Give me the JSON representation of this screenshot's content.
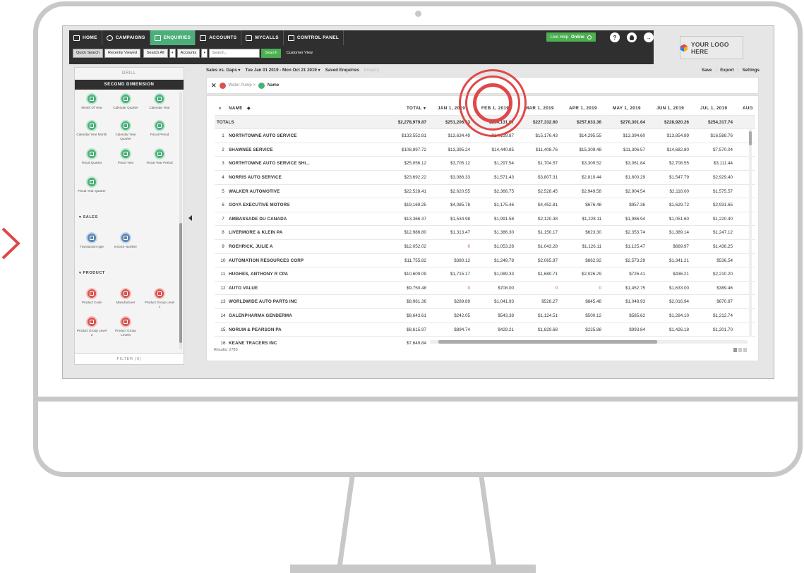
{
  "nav": {
    "items": [
      {
        "label": "HOME",
        "icon": "home-icon"
      },
      {
        "label": "CAMPAIGNS",
        "icon": "campaigns-icon"
      },
      {
        "label": "ENQUIRIES",
        "icon": "enquiries-icon",
        "active": true
      },
      {
        "label": "ACCOUNTS",
        "icon": "bank-icon"
      },
      {
        "label": "MYCALLS",
        "icon": "calls-icon"
      },
      {
        "label": "CONTROL PANEL",
        "icon": "control-panel-icon"
      }
    ],
    "help_prefix": "Live Help",
    "help_status": "Online",
    "help_q": "?",
    "logo_text": "YOUR LOGO HERE"
  },
  "search": {
    "quick": "Quick Search",
    "recent": "Recently Viewed",
    "scope": "Search All",
    "entity": "Accounts",
    "placeholder": "Search...",
    "button": "Search",
    "customer_view": "Customer View"
  },
  "left": {
    "drill": "DRILL",
    "second_dimension": "SECOND DIMENSION",
    "time_items": [
      "Month Of Year",
      "Calendar Quarter",
      "Calendar Year",
      "Calendar Year Month",
      "Calendar Year Quarter",
      "Fiscal Period",
      "Fiscal Quarter",
      "Fiscal Year",
      "Fiscal Year Period",
      "Fiscal Year Quarter"
    ],
    "sales_head": "SALES",
    "sales_items": [
      "Transaction type",
      "Invoice Number"
    ],
    "product_head": "PRODUCT",
    "product_items": [
      "Product Code",
      "Manufacturer",
      "Product Group Level 1",
      "Product Group Level 2",
      "Product Group Level3"
    ],
    "filter": "FILTER (0)"
  },
  "toolbar": {
    "report": "Sales vs. Gaps",
    "range": "Tue Jan 01 2019 - Mon Oct 21 2019",
    "saved": "Saved Enquiries",
    "enquiry": "Enquiry",
    "save": "Save",
    "export": "Export",
    "settings": "Settings"
  },
  "breadcrumb": {
    "x": "✕",
    "first": "Water Pump >",
    "second": "Name"
  },
  "table": {
    "headers": {
      "name": "NAME",
      "total": "TOTAL",
      "months": [
        "JAN 1, 2019",
        "FEB 1, 2019",
        "MAR 1, 2019",
        "APR 1, 2019",
        "MAY 1, 2019",
        "JUN 1, 2019",
        "JUL 1, 2019",
        "AUG"
      ]
    },
    "totals": {
      "label": "TOTALS",
      "total": "$2,278,979.87",
      "months": [
        "$251,206.63",
        "$214,131.67",
        "$227,332.60",
        "$257,633.36",
        "$270,301.64",
        "$228,920.26",
        "$254,317.74",
        "$"
      ]
    },
    "rows": [
      {
        "idx": "1",
        "name": "NORTHTOWNE AUTO SERVICE",
        "total": "$133,552.81",
        "months": [
          "$13,634.49",
          "$14,159.87",
          "$15,176.43",
          "$14,295.55",
          "$13,394.60",
          "$13,854.89",
          "$16,588.76"
        ]
      },
      {
        "idx": "2",
        "name": "SHAWNEE SERVICE",
        "total": "$108,897.72",
        "months": [
          "$13,395.24",
          "$14,440.85",
          "$11,408.76",
          "$15,309.48",
          "$11,306.57",
          "$14,682.80",
          "$7,570.04"
        ]
      },
      {
        "idx": "3",
        "name": "NORTHTOWNE AUTO SERVICE SHI...",
        "total": "$25,056.12",
        "months": [
          "$3,705.12",
          "$1,297.54",
          "$1,704.57",
          "$3,309.52",
          "$3,061.84",
          "$2,708.55",
          "$3,111.44"
        ]
      },
      {
        "idx": "4",
        "name": "NORRIS AUTO SERVICE",
        "total": "$23,692.22",
        "months": [
          "$3,086.33",
          "$1,571.43",
          "$3,807.31",
          "$2,810.44",
          "$1,600.29",
          "$1,547.79",
          "$2,929.40"
        ]
      },
      {
        "idx": "5",
        "name": "WALKER AUTOMOTIVE",
        "total": "$22,528.41",
        "months": [
          "$2,620.55",
          "$2,366.75",
          "$2,528.45",
          "$2,949.58",
          "$2,904.54",
          "$2,118.00",
          "$1,575.57"
        ]
      },
      {
        "idx": "6",
        "name": "GOYA EXECUTIVE MOTORS",
        "total": "$19,169.25",
        "months": [
          "$4,085.78",
          "$1,175.46",
          "$4,452.81",
          "$676.48",
          "$957.36",
          "$1,629.72",
          "$2,931.65"
        ]
      },
      {
        "idx": "7",
        "name": "AMBASSADE DU CANADA",
        "total": "$13,366.37",
        "months": [
          "$1,534.98",
          "$1,991.58",
          "$2,120.38",
          "$1,228.11",
          "$1,986.94",
          "$1,051.60",
          "$1,220.40"
        ]
      },
      {
        "idx": "8",
        "name": "LIVERMORE & KLEIN PA",
        "total": "$12,986.80",
        "months": [
          "$1,313.47",
          "$1,386.30",
          "$1,150.17",
          "$623.30",
          "$2,353.74",
          "$1,389.14",
          "$1,247.12"
        ]
      },
      {
        "idx": "9",
        "name": "ROEHRICK, JULIE A",
        "total": "$12,052.02",
        "months": [
          "0",
          "$1,053.28",
          "$1,043.28",
          "$1,126.11",
          "$1,125.47",
          "$669.97",
          "$1,436.25"
        ]
      },
      {
        "idx": "10",
        "name": "AUTOMATION RESOURCES CORP",
        "total": "$11,755.82",
        "months": [
          "$380.12",
          "$1,249.78",
          "$2,065.97",
          "$862.92",
          "$2,573.29",
          "$1,341.21",
          "$536.54"
        ]
      },
      {
        "idx": "11",
        "name": "HUGHES, ANTHONY R CPA",
        "total": "$10,609.09",
        "months": [
          "$1,715.17",
          "$1,089.33",
          "$1,680.71",
          "$2,026.29",
          "$726.41",
          "$436.21",
          "$2,210.20"
        ]
      },
      {
        "idx": "12",
        "name": "AUTO VALUE",
        "total": "$9,750.48",
        "months": [
          "0",
          "$708.00",
          "0",
          "0",
          "$1,452.75",
          "$1,633.00",
          "$389.46"
        ]
      },
      {
        "idx": "13",
        "name": "WORLDWIDE AUTO PARTS INC",
        "total": "$8,961.36",
        "months": [
          "$289.89",
          "$1,041.93",
          "$528.27",
          "$845.48",
          "$1,048.93",
          "$2,016.94",
          "$670.87"
        ]
      },
      {
        "idx": "14",
        "name": "GALENPHARMA GENDERMA",
        "total": "$8,643.61",
        "months": [
          "$242.05",
          "$543.38",
          "$1,124.51",
          "$500.12",
          "$585.62",
          "$1,284.10",
          "$1,212.74"
        ]
      },
      {
        "idx": "15",
        "name": "NORUM & PEARSON PA",
        "total": "$8,615.97",
        "months": [
          "$894.74",
          "$429.21",
          "$1,829.68",
          "$225.88",
          "$993.84",
          "$1,426.18",
          "$1,201.70"
        ]
      },
      {
        "idx": "16",
        "name": "KEANE TRACERS INC",
        "total": "$7,649.84",
        "months": [
          "",
          "",
          "",
          "",
          "",
          "",
          ""
        ]
      }
    ],
    "results": "Results: 2783"
  },
  "colors": {
    "accent_green": "#4caf7a",
    "highlight_red": "#e04848",
    "nav_dark": "#2f2f2f"
  }
}
